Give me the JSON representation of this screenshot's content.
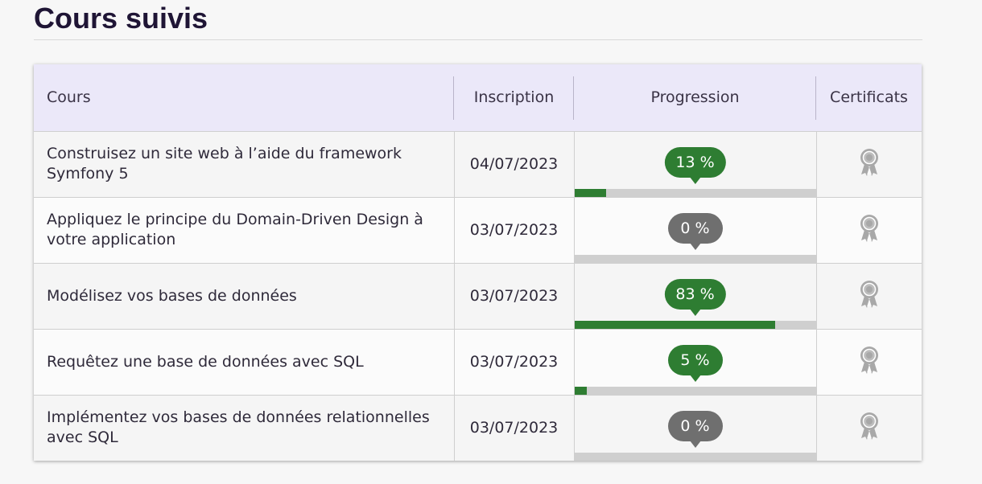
{
  "page": {
    "title": "Cours suivis"
  },
  "table": {
    "headers": {
      "course": "Cours",
      "enrollment": "Inscription",
      "progress": "Progression",
      "certificates": "Certificats"
    },
    "rows": [
      {
        "course": "Construisez un site web à l’aide du framework Symfony 5",
        "date": "04/07/2023",
        "progress_label": "13 %",
        "progress": 0.13,
        "status": "in-progress",
        "certificate_icon": "medal-icon"
      },
      {
        "course": "Appliquez le principe du Domain-Driven Design à votre application",
        "date": "03/07/2023",
        "progress_label": "0 %",
        "progress": 0.0,
        "status": "not-started",
        "certificate_icon": "medal-icon"
      },
      {
        "course": "Modélisez vos bases de données",
        "date": "03/07/2023",
        "progress_label": "83 %",
        "progress": 0.83,
        "status": "in-progress",
        "certificate_icon": "medal-icon"
      },
      {
        "course": "Requêtez une base de données avec SQL",
        "date": "03/07/2023",
        "progress_label": "5 %",
        "progress": 0.05,
        "status": "in-progress",
        "certificate_icon": "medal-icon"
      },
      {
        "course": "Implémentez vos bases de données relationnelles avec SQL",
        "date": "03/07/2023",
        "progress_label": "0 %",
        "progress": 0.0,
        "status": "not-started",
        "certificate_icon": "medal-icon"
      }
    ]
  },
  "colors": {
    "accent_green": "#2e7d32",
    "neutral_grey": "#6f6f6f",
    "header_bg": "#ebe8f9",
    "track": "#cfcfcf",
    "title": "#1f1535"
  }
}
